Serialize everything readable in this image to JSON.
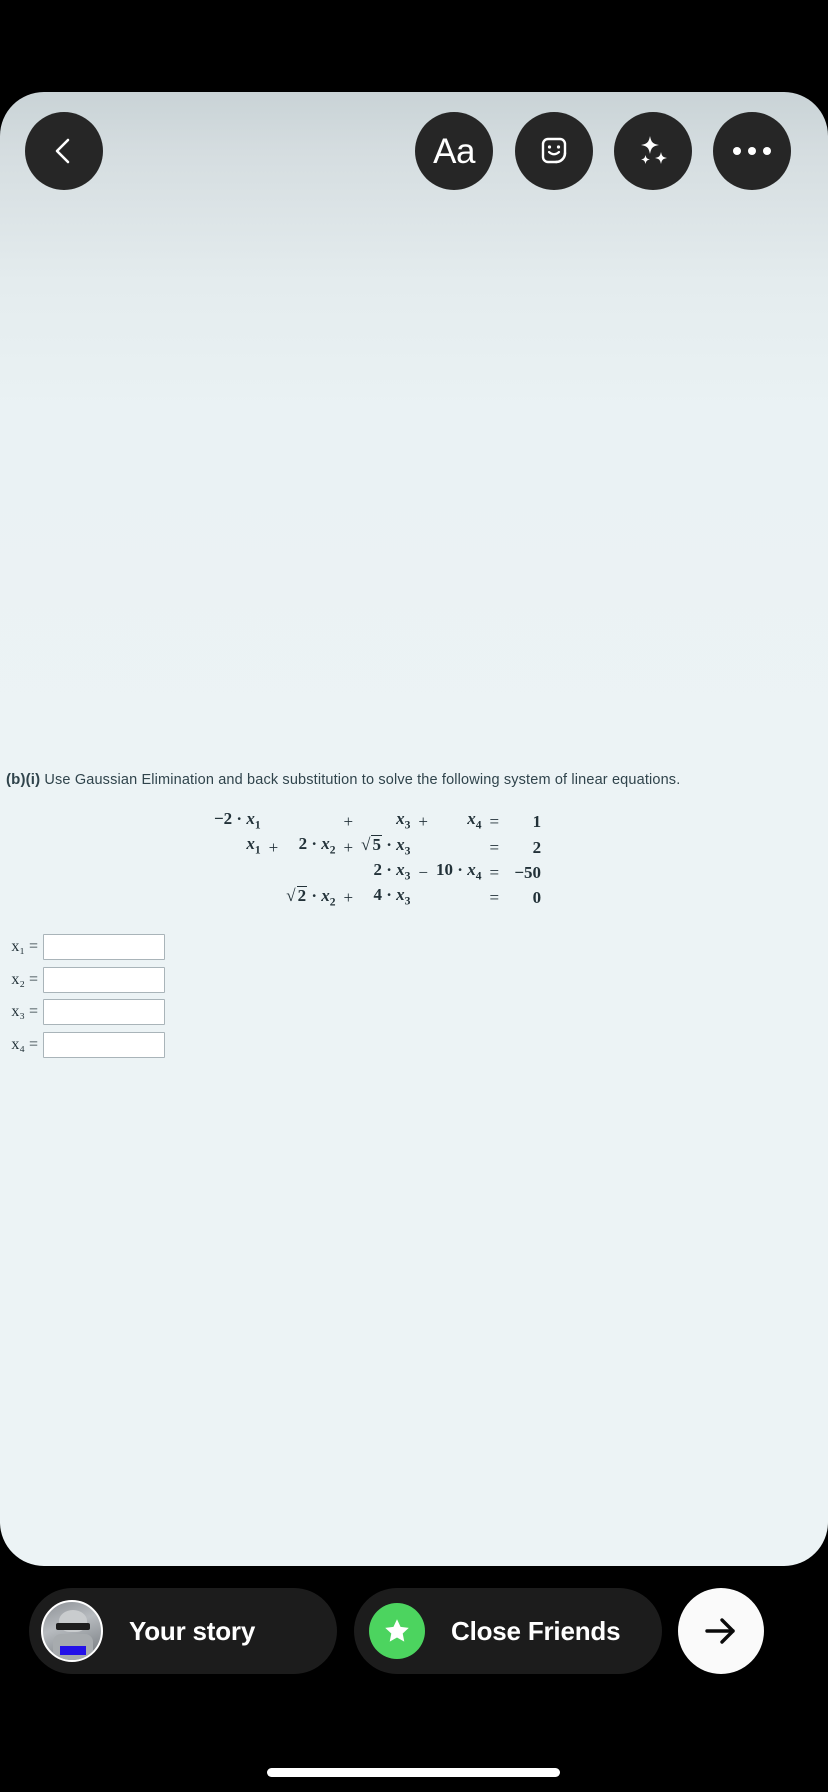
{
  "app": {
    "screen_name": "instagram-story-share-composer",
    "background_color": "#000000",
    "card_gradient_top": "#c9d3d6",
    "card_gradient_bottom": "#ecf3f5"
  },
  "toolbar": {
    "back_icon": "chevron-left-icon",
    "text_tool_label": "Aa",
    "sticker_icon": "sticker-smiley-icon",
    "effects_icon": "sparkles-icon",
    "more_icon": "ellipsis-icon",
    "button_color": "#262626",
    "icon_color": "#ffffff"
  },
  "worksheet": {
    "question_label": "(b)(i)",
    "question_text": "Use Gaussian Elimination and back substitution to solve the following system of linear equations.",
    "equations": [
      {
        "terms": [
          {
            "coefficient": "−2 ·",
            "variable": "x",
            "subscript": "1"
          },
          {
            "operator": "",
            "coefficient": "",
            "variable": "",
            "subscript": ""
          },
          {
            "operator": "+",
            "coefficient": "",
            "variable": "x",
            "subscript": "3"
          },
          {
            "operator": "+",
            "coefficient": "",
            "variable": "x",
            "subscript": "4"
          }
        ],
        "relation": "=",
        "rhs": "1"
      },
      {
        "terms": [
          {
            "coefficient": "",
            "variable": "x",
            "subscript": "1"
          },
          {
            "operator": "+",
            "coefficient": "2 ·",
            "variable": "x",
            "subscript": "2"
          },
          {
            "operator": "+",
            "coefficient": "√5 ·",
            "variable": "x",
            "subscript": "3"
          },
          {
            "operator": "",
            "coefficient": "",
            "variable": "",
            "subscript": ""
          }
        ],
        "relation": "=",
        "rhs": "2"
      },
      {
        "terms": [
          {
            "coefficient": "",
            "variable": "",
            "subscript": ""
          },
          {
            "operator": "",
            "coefficient": "",
            "variable": "",
            "subscript": ""
          },
          {
            "operator": "",
            "coefficient": "2 ·",
            "variable": "x",
            "subscript": "3"
          },
          {
            "operator": "−",
            "coefficient": "10 ·",
            "variable": "x",
            "subscript": "4"
          }
        ],
        "relation": "=",
        "rhs": "−50"
      },
      {
        "terms": [
          {
            "coefficient": "",
            "variable": "",
            "subscript": ""
          },
          {
            "operator": "",
            "coefficient": "√2 ·",
            "variable": "x",
            "subscript": "2"
          },
          {
            "operator": "+",
            "coefficient": "4 ·",
            "variable": "x",
            "subscript": "3"
          },
          {
            "operator": "",
            "coefficient": "",
            "variable": "",
            "subscript": ""
          }
        ],
        "relation": "=",
        "rhs": "0"
      }
    ],
    "answer_fields": [
      {
        "label": "x₁ =",
        "value": "",
        "placeholder": ""
      },
      {
        "label": "x₂ =",
        "value": "",
        "placeholder": ""
      },
      {
        "label": "x₃ =",
        "value": "",
        "placeholder": ""
      },
      {
        "label": "x₄ =",
        "value": "",
        "placeholder": ""
      }
    ]
  },
  "bottom_bar": {
    "your_story_label": "Your story",
    "your_story_avatar_icon": "user-avatar",
    "close_friends_label": "Close Friends",
    "close_friends_icon": "star-icon",
    "close_friends_badge_color": "#4cd45f",
    "next_icon": "arrow-right-icon",
    "next_button_color": "#fafafa"
  }
}
